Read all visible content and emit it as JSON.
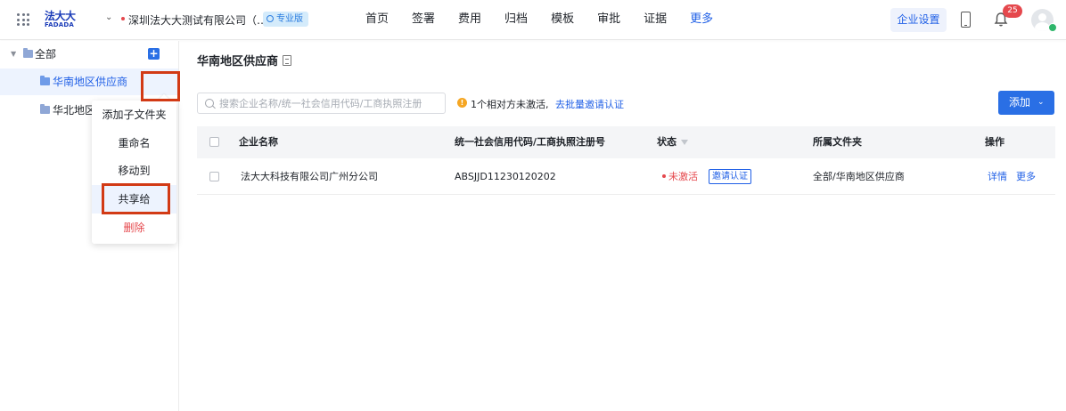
{
  "header": {
    "logo_cn": "法大大",
    "logo_en": "FADADA",
    "company_name": "深圳法大大测试有限公司（…",
    "edition_badge": "专业版",
    "nav": [
      "首页",
      "签署",
      "费用",
      "归档",
      "模板",
      "审批",
      "证据",
      "更多"
    ],
    "active_nav": "更多",
    "enterprise_settings": "企业设置",
    "notification_count": "25"
  },
  "sidebar": {
    "root_label": "全部",
    "items": [
      {
        "label": "华南地区供应商",
        "selected": true
      },
      {
        "label": "华北地区"
      }
    ],
    "context_menu": [
      "添加子文件夹",
      "重命名",
      "移动到",
      "共享给",
      "删除"
    ]
  },
  "main": {
    "title": "华南地区供应商",
    "search_placeholder": "搜索企业名称/统一社会信用代码/工商执照注册",
    "notice_text": "1个相对方未激活,",
    "notice_link": "去批量邀请认证",
    "add_button": "添加",
    "table": {
      "columns": [
        "企业名称",
        "统一社会信用代码/工商执照注册号",
        "状态",
        "所属文件夹",
        "操作"
      ],
      "rows": [
        {
          "name": "法大大科技有限公司广州分公司",
          "code": "ABSJJD11230120202",
          "status": "未激活",
          "status_action": "邀请认证",
          "folder": "全部/华南地区供应商",
          "action_detail": "详情",
          "action_more": "更多"
        }
      ]
    }
  },
  "colors": {
    "primary": "#1f5fe6",
    "danger": "#e5484d",
    "highlight_box": "#d23a15"
  }
}
